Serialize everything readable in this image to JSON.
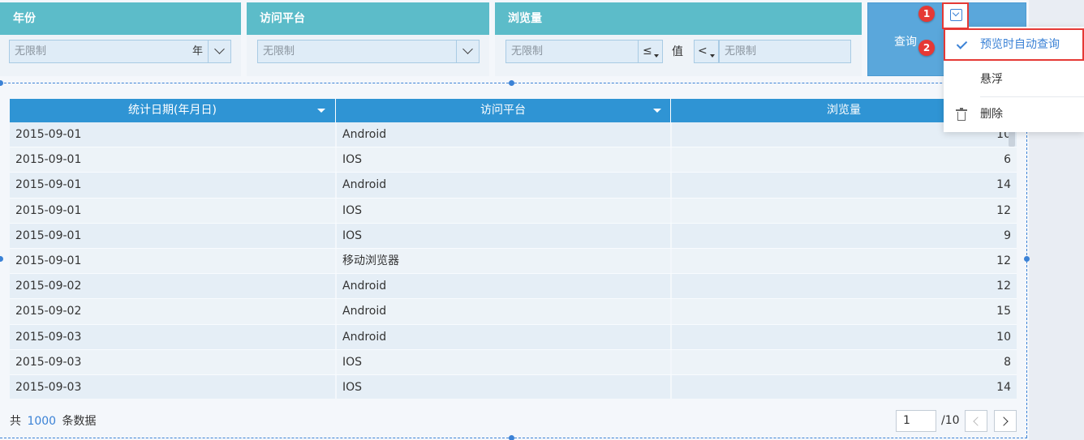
{
  "filters": [
    {
      "title": "年份",
      "placeholder": "无限制",
      "unit": "年"
    },
    {
      "title": "访问平台",
      "placeholder": "无限制"
    },
    {
      "title": "浏览量",
      "placeholder": "无限制",
      "op1": "≤",
      "value_label": "值",
      "op2": "<",
      "placeholder2": "无限制"
    }
  ],
  "query_button": {
    "label": "查询"
  },
  "table": {
    "columns": [
      "统计日期(年月日)",
      "访问平台",
      "浏览量"
    ],
    "rows": [
      [
        "2015-09-01",
        "Android",
        "10"
      ],
      [
        "2015-09-01",
        "IOS",
        "6"
      ],
      [
        "2015-09-01",
        "Android",
        "14"
      ],
      [
        "2015-09-01",
        "IOS",
        "12"
      ],
      [
        "2015-09-01",
        "IOS",
        "9"
      ],
      [
        "2015-09-01",
        "移动浏览器",
        "12"
      ],
      [
        "2015-09-02",
        "Android",
        "12"
      ],
      [
        "2015-09-02",
        "Android",
        "15"
      ],
      [
        "2015-09-03",
        "Android",
        "10"
      ],
      [
        "2015-09-03",
        "IOS",
        "8"
      ],
      [
        "2015-09-03",
        "IOS",
        "14"
      ]
    ]
  },
  "footer": {
    "prefix": "共",
    "count": "1000",
    "suffix": "条数据",
    "page": "1",
    "total_pages": "/10"
  },
  "badges": [
    "1",
    "2"
  ],
  "menu": {
    "items": [
      "预览时自动查询",
      "悬浮",
      "删除"
    ]
  },
  "colors": {
    "filter_header": "#5cbcc9",
    "table_header": "#2f94d4",
    "accent": "#3b82d6",
    "highlight": "#e53935"
  }
}
